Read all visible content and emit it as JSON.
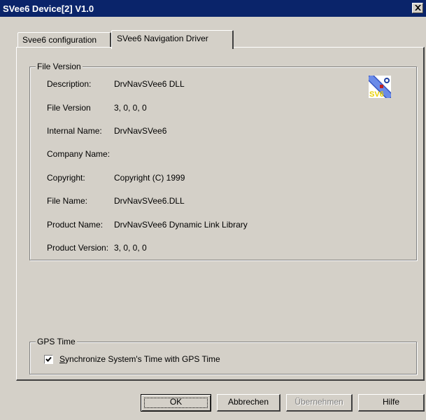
{
  "window": {
    "title": "SVee6 Device[2] V1.0"
  },
  "tabs": [
    {
      "label": "Svee6 configuration"
    },
    {
      "label": "SVee6 Navigation Driver"
    }
  ],
  "file_version": {
    "legend": "File Version",
    "icon_label": "SV6",
    "rows": [
      {
        "label": "Description:",
        "value": "DrvNavSVee6 DLL"
      },
      {
        "label": "File Version",
        "value": "3, 0, 0, 0"
      },
      {
        "label": "Internal Name:",
        "value": "DrvNavSVee6"
      },
      {
        "label": "Company Name:",
        "value": ""
      },
      {
        "label": "Copyright:",
        "value": "Copyright (C) 1999"
      },
      {
        "label": "File Name:",
        "value": "DrvNavSVee6.DLL"
      },
      {
        "label": "Product Name:",
        "value": "DrvNavSVee6 Dynamic Link Library"
      },
      {
        "label": "Product Version:",
        "value": "3, 0, 0, 0"
      }
    ]
  },
  "gps_time": {
    "legend": "GPS Time",
    "checkbox_label_first": "S",
    "checkbox_label_rest": "ynchronize System's Time with GPS Time",
    "checked": true
  },
  "buttons": {
    "ok": "OK",
    "cancel": "Abbrechen",
    "apply": "Übernehmen",
    "help": "Hilfe"
  }
}
